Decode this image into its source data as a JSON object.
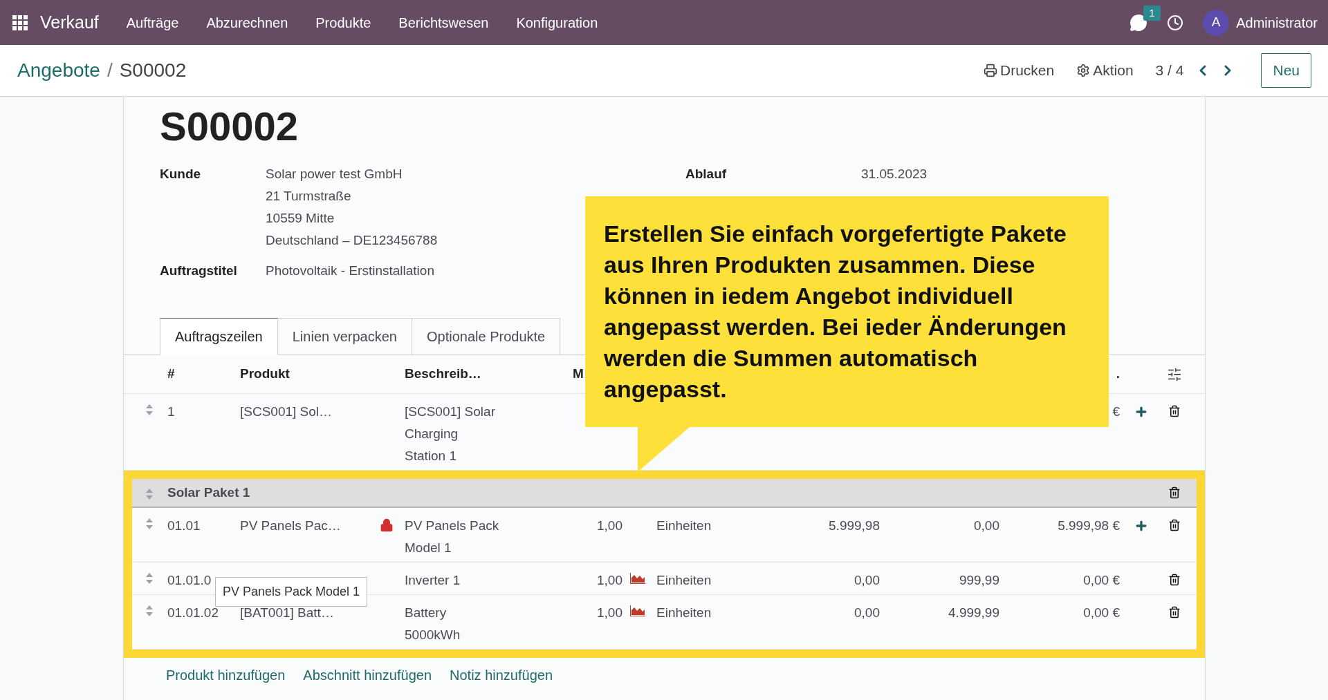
{
  "navbar": {
    "app": "Verkauf",
    "menu": [
      "Aufträge",
      "Abzurechnen",
      "Produkte",
      "Berichtswesen",
      "Konfiguration"
    ],
    "chat_badge": "1",
    "user_initial": "A",
    "user": "Administrator"
  },
  "control_panel": {
    "breadcrumb": "Angebote",
    "separator": "/",
    "record": "S00002",
    "actions": [
      "Drucken",
      "Aktion"
    ],
    "pager": "3 / 4",
    "new_button": "Neu"
  },
  "form": {
    "title": "S00002",
    "fields": [
      {
        "label": "Kunde",
        "lines": [
          "Solar power test GmbH",
          "21 Turmstraße",
          "10559 Mitte",
          "Deutschland – DE123456788"
        ]
      },
      {
        "label": "Auftragstitel",
        "lines": [
          "Photovoltaik - Erstinstallation"
        ]
      }
    ],
    "expiry": {
      "label": "Ablauf",
      "value": "31.05.2023"
    }
  },
  "tabs": [
    {
      "label": "Auftragszeilen",
      "selected": true
    },
    {
      "label": "Linien verpacken",
      "selected": false
    },
    {
      "label": "Optionale Produkte",
      "selected": false
    }
  ],
  "table": {
    "columns": [
      "#",
      "Produkt",
      "Beschreib…",
      "M",
      "."
    ],
    "rows": [
      {
        "kind": "line",
        "highlighted": false,
        "number": "1",
        "product": "[SCS001] Sol…",
        "locked": false,
        "description": [
          "[SCS001] Solar",
          "Charging",
          "Station 1"
        ],
        "forecast": false,
        "subtotal": "€",
        "can_add": true
      },
      {
        "kind": "section",
        "highlighted": true,
        "name": "Solar Paket 1"
      },
      {
        "kind": "line",
        "highlighted": true,
        "number": "01.01",
        "product": "PV Panels Pac…",
        "locked": true,
        "description": [
          "PV Panels Pack",
          "Model 1"
        ],
        "quantity": "1,00",
        "forecast": false,
        "unit": "Einheiten",
        "price": "5.999,98",
        "discount": "0,00",
        "subtotal": "5.999,98 €",
        "can_add": true
      },
      {
        "kind": "line",
        "highlighted": true,
        "number": "01.01.0",
        "product": "",
        "locked": false,
        "description": [
          "Inverter 1"
        ],
        "quantity": "1,00",
        "forecast": true,
        "unit": "Einheiten",
        "price": "0,00",
        "discount": "999,99",
        "subtotal": "0,00 €",
        "can_add": false
      },
      {
        "kind": "line",
        "highlighted": true,
        "number": "01.01.02",
        "product": "[BAT001] Batt…",
        "locked": false,
        "description": [
          "Battery",
          "5000kWh"
        ],
        "quantity": "1,00",
        "forecast": true,
        "unit": "Einheiten",
        "price": "0,00",
        "discount": "4.999,99",
        "subtotal": "0,00 €",
        "can_add": false
      }
    ],
    "tooltip": "PV Panels Pack Model 1",
    "add_links": [
      "Produkt hinzufügen",
      "Abschnitt hinzufügen",
      "Notiz hinzufügen"
    ]
  },
  "callout": "Erstellen Sie einfach vorgefertigte Pakete aus Ihren Produkten zusammen. Diese können in iedem Angebot individuell angepasst werden. Bei ieder Änderungen werden die Summen automatisch angepasst."
}
